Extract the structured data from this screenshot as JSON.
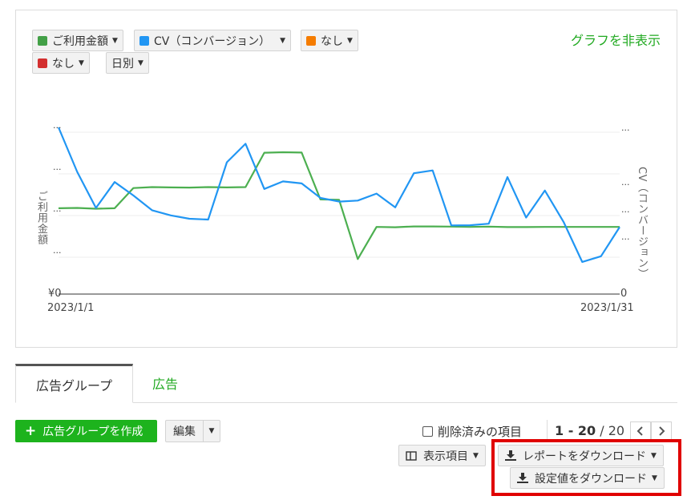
{
  "metric_selectors": [
    {
      "label": "ご利用金額",
      "color": "#43a047"
    },
    {
      "label": "CV（コンバージョン）",
      "color": "#2196f3"
    },
    {
      "label": "なし",
      "color": "#f57c00"
    },
    {
      "label": "なし",
      "color": "#d32f2f"
    }
  ],
  "period_selector": {
    "label": "日別"
  },
  "hide_graph_link": "グラフを非表示",
  "chart_data": {
    "type": "line",
    "x_start_label": "2023/1/1",
    "x_end_label": "2023/1/31",
    "y_left_label": "ご利用金額",
    "y_right_label": "CV（コンバージョン）",
    "y_left_zero_label": "¥0",
    "y_right_zero_label": "0",
    "y_left_tick_labels": [
      "...",
      "...",
      "...",
      "..."
    ],
    "y_right_tick_labels": [
      "...",
      "...",
      "...",
      "..."
    ],
    "ylim": [
      0,
      100
    ],
    "x": [
      1,
      2,
      3,
      4,
      5,
      6,
      7,
      8,
      9,
      10,
      11,
      12,
      13,
      14,
      15,
      16,
      17,
      18,
      19,
      20,
      21,
      22,
      23,
      24,
      25,
      26,
      27,
      28,
      29,
      30,
      31
    ],
    "series": [
      {
        "name": "ご利用金額",
        "color": "#4caf50",
        "values": [
          51.5,
          51.7,
          51.2,
          51.5,
          63.6,
          64.2,
          64.0,
          63.9,
          64.2,
          64.0,
          64.2,
          84.8,
          85.1,
          84.9,
          56.8,
          56.6,
          21.0,
          40.3,
          40.1,
          40.6,
          40.6,
          40.5,
          40.3,
          40.5,
          40.2,
          40.2,
          40.3,
          40.3,
          40.3,
          40.3,
          40.3
        ]
      },
      {
        "name": "CV（コンバージョン）",
        "color": "#2196f3",
        "values": [
          100,
          73.3,
          51.7,
          67.2,
          59.2,
          50.3,
          47.2,
          45.2,
          44.7,
          79.1,
          90.2,
          63.1,
          67.6,
          66.4,
          57.7,
          55.5,
          56.1,
          60.3,
          52.0,
          72.5,
          74.2,
          41.2,
          41.3,
          42.2,
          70.2,
          45.9,
          62.1,
          43.3,
          19.3,
          22.7,
          40.2
        ]
      }
    ]
  },
  "tabs": {
    "active": "広告グループ",
    "other": "広告"
  },
  "toolbar": {
    "create_button": "広告グループを作成",
    "edit_button": "編集",
    "deleted_label": "削除済みの項目",
    "pager_range": "1 - 20",
    "pager_sep": " / ",
    "pager_total": "20",
    "prev_icon": "chevron-left-icon",
    "next_icon": "chevron-right-icon",
    "columns_button": "表示項目",
    "report_download_button": "レポートをダウンロード",
    "settings_download_button": "設定値をダウンロード"
  },
  "colors": {
    "accent_green": "#1db31d",
    "link_green": "#22aa22",
    "highlight_red": "#e00000"
  }
}
